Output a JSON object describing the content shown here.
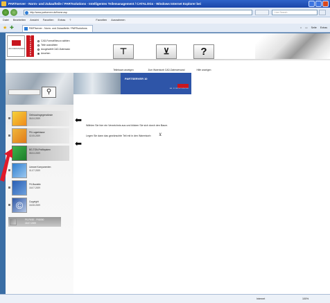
{
  "browser": {
    "title": "PARTserver - Norm- und Zukaufteile / PARTsolutions - Intelligentes Teilemanagement / CATALOGs - Windows Internet Explorer bei",
    "address": "http://www.partserver.de/frame.asp",
    "search_placeholder": "Live Search",
    "menu": [
      "Datei",
      "Bearbeiten",
      "Ansicht",
      "Favoriten",
      "Extras",
      "?"
    ],
    "links": [
      "Favoriten",
      "Ausnahmen"
    ],
    "tab_label": "PARTserver - Norm- und Zukaufteile / PARTsolutions",
    "commands": [
      "Seite",
      "Extras"
    ]
  },
  "header": {
    "logo_text": "AB KOMPETENZEN",
    "brand_text": "PARTSERVER",
    "options": [
      {
        "label": "CAD-Format/Neuzu wählen",
        "selected": false
      },
      {
        "label": "Teile auswählen",
        "selected": false
      },
      {
        "label": "Ausgewählt CAD-Datensatz",
        "selected": false
      },
      {
        "label": "Ansehen",
        "selected": true
      }
    ],
    "tools": [
      {
        "label": "Teilebaum anzeigen",
        "icon": "tree-icon",
        "glyph": "⊤"
      },
      {
        "label": "Zum Warenkorb CAD-Datenversand",
        "icon": "cart-icon",
        "glyph": "⊻"
      },
      {
        "label": "Hilfe anzeigen",
        "icon": "help-icon",
        "glyph": "?"
      }
    ]
  },
  "sidebar": {
    "categories": [
      {
        "name": "Gebrauchsgegenstände",
        "date": "06.04.2009",
        "colors": [
          "#f4d23a",
          "#f08a1c"
        ]
      },
      {
        "name": "PK-Lagerklasse",
        "date": "02.05.2009",
        "colors": [
          "#f0b63a",
          "#e07a1a"
        ]
      },
      {
        "name": "BG-TGN-Profilsystem",
        "date": "08.04.2009",
        "colors": [
          "#3fb24a",
          "#1b7d2a"
        ]
      },
      {
        "name": "Lineare Komponenten",
        "date": "01.07.2009",
        "colors": [
          "#2f7fd0",
          "#9cc8ef"
        ]
      },
      {
        "name": "FK-Bauteile",
        "date": "18.07.2009",
        "colors": [
          "#2a5fb5",
          "#6ea1dd"
        ]
      },
      {
        "name": "Copyright",
        "date": "18.08.2009",
        "colors": [
          "#2d57a7",
          "#b7c8e4"
        ],
        "glyph": "©"
      },
      {
        "name": "FK-FKSE - FK8050",
        "date": "18.07.2009",
        "colors": [
          "#8c8c8c",
          "#d0d0d0"
        ]
      }
    ]
  },
  "main": {
    "banner_title": "PARTSERVER 10",
    "banner_logo_text": "AB KOMPETENZEN",
    "instructions": [
      "Wählen Sie hier ein Verzeichnis aus und klicken Sie sich durch den Baum.",
      "Legen Sie dann das gewünschte Teil mit  in den Warenkorb"
    ]
  },
  "status": {
    "zone": "Internet",
    "zoom": "100%"
  }
}
